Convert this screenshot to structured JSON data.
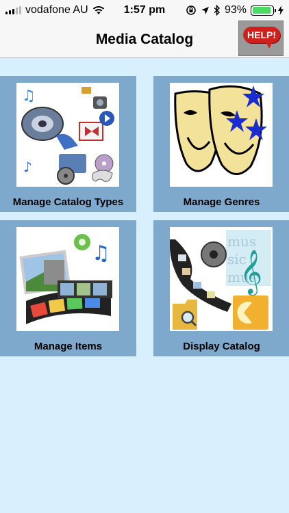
{
  "status_bar": {
    "carrier": "vodafone AU",
    "time": "1:57 pm",
    "battery_percent": "93%",
    "battery_level": 0.93,
    "icons": [
      "signal-icon",
      "wifi-icon",
      "rotation-lock-icon",
      "location-icon",
      "bluetooth-icon",
      "battery-icon",
      "charging-icon"
    ]
  },
  "nav": {
    "title": "Media Catalog",
    "help_label": "HELP!"
  },
  "tiles": [
    {
      "label": "Manage Catalog Types",
      "icon": "media-types-icon"
    },
    {
      "label": "Manage Genres",
      "icon": "theater-masks-icon"
    },
    {
      "label": "Manage Items",
      "icon": "film-strip-icon"
    },
    {
      "label": "Display Catalog",
      "icon": "film-reel-music-icon"
    }
  ],
  "colors": {
    "background": "#d8f0fd",
    "tile": "#7ea8cc",
    "help_red": "#d0201c",
    "battery_green": "#4cd964"
  }
}
